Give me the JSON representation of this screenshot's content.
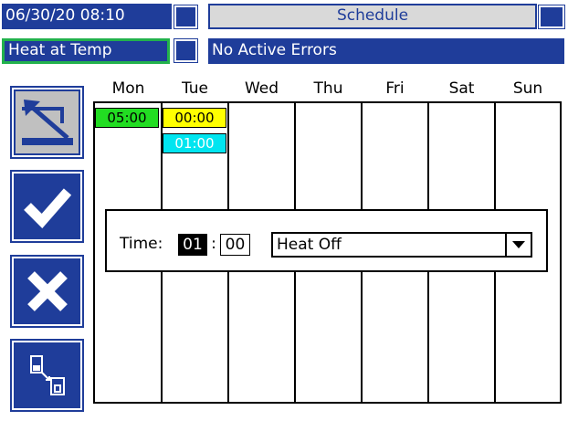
{
  "header": {
    "datetime": "06/30/20 08:10",
    "title": "Schedule",
    "heat_status": "Heat at Temp",
    "error_status": "No Active Errors"
  },
  "sidebar": {
    "buttons": [
      {
        "name": "exit-screen-button",
        "icon": "exit-arrow-icon"
      },
      {
        "name": "accept-button",
        "icon": "checkmark-icon"
      },
      {
        "name": "cancel-button",
        "icon": "x-icon"
      },
      {
        "name": "copy-button",
        "icon": "copy-icon"
      }
    ]
  },
  "schedule": {
    "days": [
      "Mon",
      "Tue",
      "Wed",
      "Thu",
      "Fri",
      "Sat",
      "Sun"
    ],
    "entries": [
      {
        "day": "Mon",
        "time": "05:00",
        "color": "#22dd22"
      },
      {
        "day": "Tue",
        "time": "00:00",
        "color": "#ffff00"
      },
      {
        "day": "Tue",
        "time": "01:00",
        "color": "#00e5f0"
      }
    ]
  },
  "dialog": {
    "time_label": "Time:",
    "hour": "01",
    "separator": ":",
    "minute": "00",
    "mode_value": "Heat Off"
  },
  "colors": {
    "primary": "#1f3d9a",
    "status_border": "#22b24c"
  }
}
